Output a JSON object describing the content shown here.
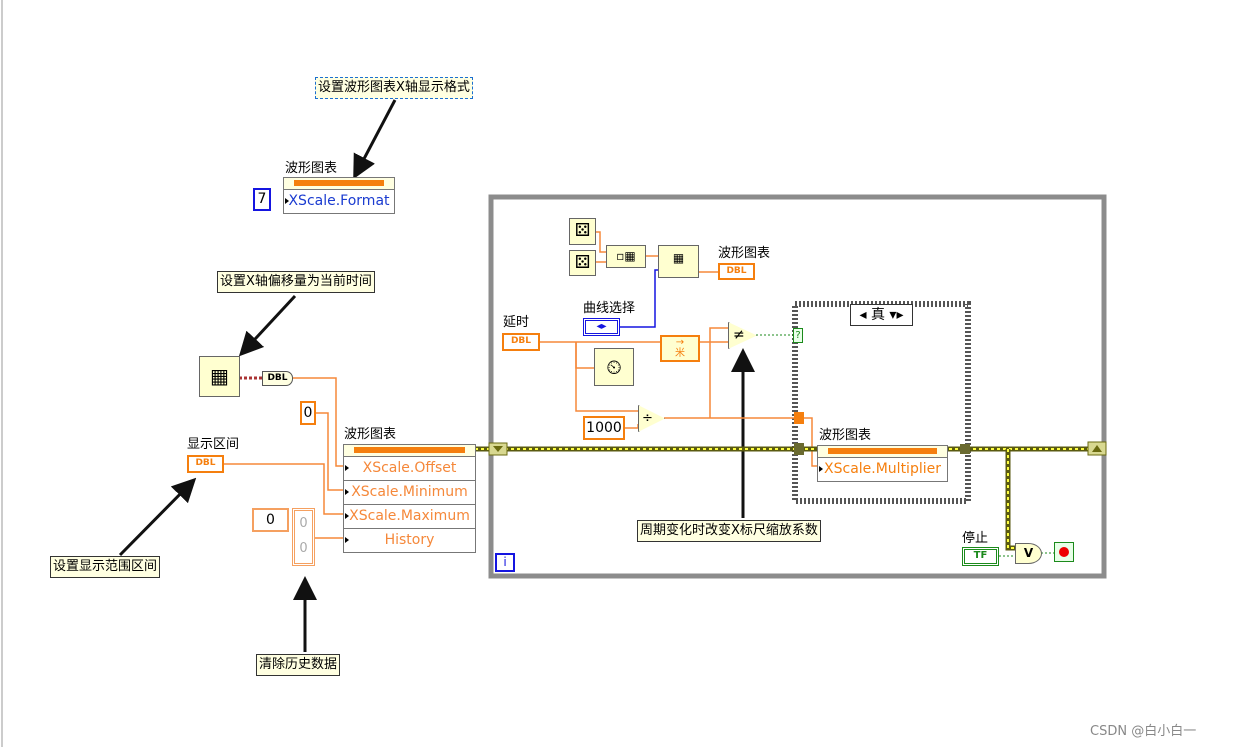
{
  "comments": {
    "xscale_format": "设置波形图表X轴显示格式",
    "offset_time": "设置X轴偏移量为当前时间",
    "display_range": "设置显示范围区间",
    "clear_history": "清除历史数据",
    "multiplier": "周期变化时改变X标尺缩放系数"
  },
  "format_node": {
    "label": "波形图表",
    "constant": "7",
    "property": "XScale.Format"
  },
  "time_node": {
    "convert": "DBL"
  },
  "offset_const": "0",
  "range_control": {
    "label": "显示区间",
    "type": "DBL"
  },
  "chart_node": {
    "label": "波形图表",
    "properties": [
      "XScale.Offset",
      "XScale.Minimum",
      "XScale.Maximum",
      "History"
    ]
  },
  "history_array": {
    "index": "0",
    "values": [
      "0",
      "0"
    ]
  },
  "loop": {
    "chart_indicator": {
      "label": "波形图表",
      "type": "DBL"
    },
    "curve_select": {
      "label": "曲线选择"
    },
    "delay": {
      "label": "延时",
      "type": "DBL"
    },
    "divisor": "1000",
    "feedback_label": "米",
    "not_equal": "≠",
    "case": {
      "selector": "真",
      "terminal": "?"
    },
    "multiplier_node": {
      "label": "波形图表",
      "property": "XScale.Multiplier"
    },
    "stop": {
      "label": "停止",
      "type": "TF"
    },
    "or": "V",
    "iteration": "i"
  },
  "colors": {
    "dbl": "#f57f0e",
    "int": "#1515e0",
    "bool": "#1b8a1b",
    "error": "#8a8a1a",
    "loop_border": "#8c8c8c"
  },
  "watermark": "CSDN @白小白一"
}
